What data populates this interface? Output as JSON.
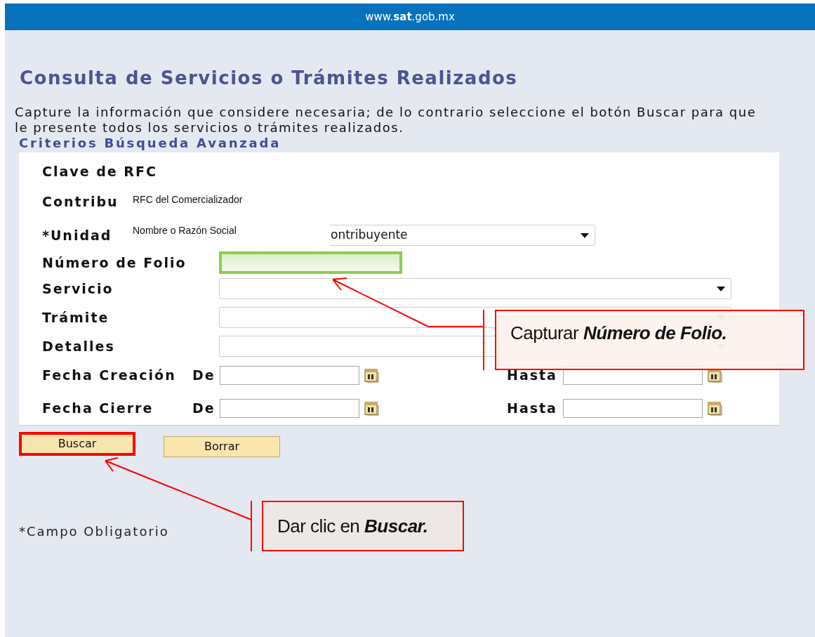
{
  "header": {
    "site": "www.**sat**.gob.mx"
  },
  "title": "Consulta de Servicios o Trámites Realizados",
  "instructions": "Capture la información que considere necesaria; de lo contrario seleccione el botón Buscar para que le presente todos los servicios o trámites realizados.",
  "section_title": "Criterios Búsqueda Avanzada",
  "fields": [
    {
      "kind": "label",
      "label": "Clave de RFC"
    },
    {
      "kind": "label",
      "label": "Contribu"
    },
    {
      "kind": "select",
      "label": "*Unidad",
      "value": "ontribuyente",
      "disabled": false
    },
    {
      "kind": "text",
      "label": "Número de Folio",
      "highlighted": true
    },
    {
      "kind": "select",
      "label": "Servicio",
      "disabled": false
    },
    {
      "kind": "select",
      "label": "Trámite",
      "disabled": true
    },
    {
      "kind": "select",
      "label": "Detalles",
      "disabled": true
    },
    {
      "kind": "date_range",
      "label": "Fecha Creación",
      "from_label": "De",
      "to_label": "Hasta"
    },
    {
      "kind": "date_range",
      "label": "Fecha Cierre",
      "from_label": "De",
      "to_label": "Hasta"
    }
  ],
  "dropdown_options": [
    "RFC del Comercializador",
    "Nombre o Razón Social"
  ],
  "buttons": [
    {
      "label": "Buscar",
      "highlighted": true
    },
    {
      "label": "Borrar",
      "highlighted": false
    }
  ],
  "required_note": "*Campo Obligatorio",
  "annotations": [
    {
      "text": "Capturar",
      "emphasis": "Número de Folio."
    },
    {
      "text": "Dar clic en",
      "emphasis": "Buscar."
    }
  ]
}
